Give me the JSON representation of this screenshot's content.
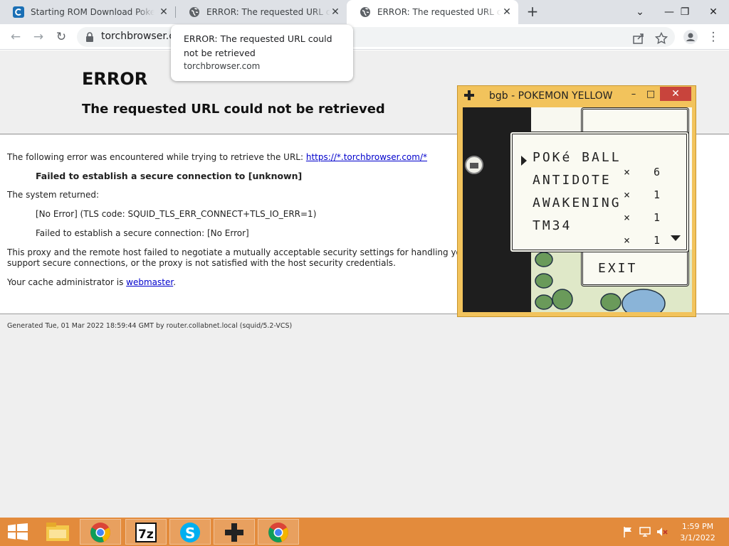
{
  "browser": {
    "tabs": [
      {
        "title": "Starting ROM Download Pokemon Yellow",
        "active": false,
        "favicon": "app-c-icon"
      },
      {
        "title": "ERROR: The requested URL could not be retrieved",
        "active": false,
        "favicon": "globe-icon"
      },
      {
        "title": "ERROR: The requested URL could not be retrieved",
        "active": true,
        "favicon": "globe-icon"
      }
    ],
    "new_tab_label": "+",
    "url": "torchbrowser.com",
    "window_controls": [
      "chevron-down-icon",
      "minimize-icon",
      "restore-icon",
      "close-icon"
    ]
  },
  "tooltip": {
    "title": "ERROR: The requested URL could not be retrieved",
    "url": "torchbrowser.com"
  },
  "error_page": {
    "heading": "ERROR",
    "subheading": "The requested URL could not be retrieved",
    "intro": "The following error was encountered while trying to retrieve the URL:",
    "intro_link": "https://*.torchbrowser.com/*",
    "failure_bold": "Failed to establish a secure connection to [unknown]",
    "system_returned": "The system returned:",
    "error_code": "[No Error] (TLS code: SQUID_TLS_ERR_CONNECT+TLS_IO_ERR=1)",
    "secure_fail": "Failed to establish a secure connection: [No Error]",
    "explanation_line1": "This proxy and the remote host failed to negotiate a mutually acceptable security settings for handling your request. It is possible that the remote host does not",
    "explanation_line2": "support secure connections, or the proxy is not satisfied with the host security credentials.",
    "cache_admin": "Your cache administrator is",
    "cache_admin_link": "webmaster",
    "cache_admin_end": ".",
    "footer": "Generated Tue, 01 Mar 2022 18:59:44 GMT by router.collabnet.local (squid/5.2-VCS)"
  },
  "emulator": {
    "title": "bgb - POKEMON YELLOW",
    "items": [
      {
        "name": "POKé BALL",
        "qty": "× 6"
      },
      {
        "name": "ANTIDOTE",
        "qty": "× 1"
      },
      {
        "name": "AWAKENING",
        "qty": "× 1"
      },
      {
        "name": "TM34",
        "qty": "× 1"
      }
    ],
    "exit_label": "EXIT"
  },
  "taskbar": {
    "apps": [
      "file-explorer-icon",
      "chrome-icon",
      "7zip-icon",
      "skype-icon",
      "bgb-icon",
      "chrome-icon"
    ],
    "time": "1:59 PM",
    "date": "3/1/2022",
    "accent": "#e38b3c"
  }
}
